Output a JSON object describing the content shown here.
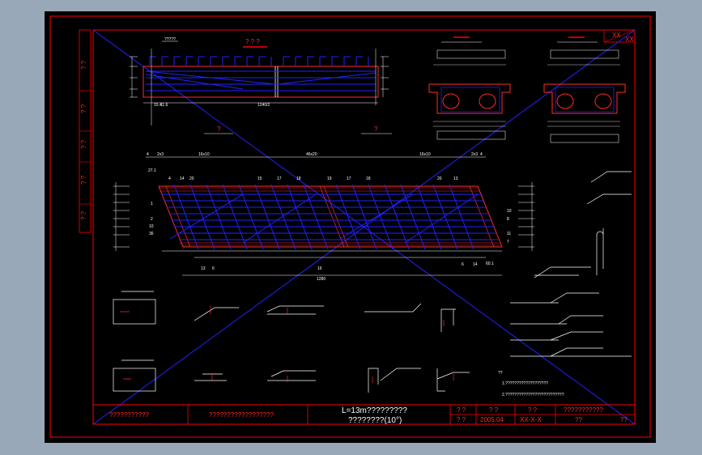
{
  "colors": {
    "background": "#000000",
    "outer": "#99a8b9",
    "frame": "#ff0000",
    "rebar": "#2222ff",
    "text": "#ffffff"
  },
  "top_section": {
    "title": "? ? ?",
    "tag": "?????",
    "midspan_label": "1240/2",
    "left_dim": "15.4",
    "end_dim": "11.6"
  },
  "cross_sections": {
    "left_mark": "?",
    "right_mark": "?"
  },
  "plan": {
    "dims_top": [
      "4",
      "2x3",
      "16x10",
      "46x20",
      "16x10",
      "2x3",
      "4"
    ],
    "bottom_length": "1280",
    "left_top": "27.1",
    "right_bottom": "60.1",
    "numbers_top": [
      "4",
      "14",
      "20",
      "15",
      "17",
      "18",
      "19",
      "17",
      "18",
      "20",
      "13"
    ],
    "numbers_bottom": [
      "13",
      "6",
      "16",
      "6",
      "14"
    ],
    "numbers_left": [
      "1",
      "2",
      "10",
      "36"
    ],
    "numbers_right": [
      "10",
      "8",
      "11",
      "7"
    ]
  },
  "notes": {
    "heading": "??",
    "line1": "1.???????????????????",
    "line2": "2.??????????????????????????"
  },
  "title_block": {
    "col1": "???????????",
    "col2": "??????????????????",
    "main_title": "L=13m?????????",
    "sub_title": "????????(10°)",
    "c4a": "? ?",
    "c4b": "? ?",
    "c5a": "? ?",
    "c5b": "2005.04",
    "c6a": "? ?",
    "c6b": "XX-X-X",
    "c7a": "???????????",
    "c7b1": "??",
    "c7b2": "??"
  },
  "corner_tag": {
    "a": "XX",
    "b": "XX"
  },
  "side_labels": [
    "? ?",
    "? ?",
    "? ?",
    "? ?",
    "? ?"
  ]
}
